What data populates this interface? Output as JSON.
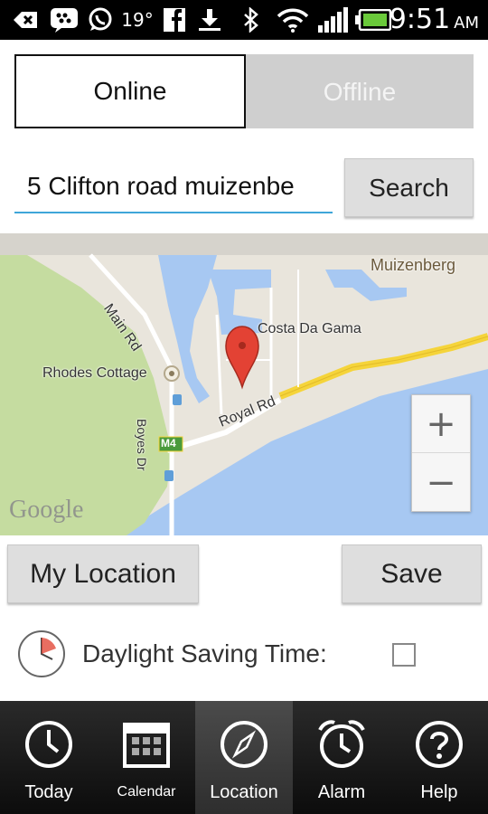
{
  "status_bar": {
    "temperature": "19°",
    "time": "9:51",
    "ampm": "AM",
    "icons": [
      "back-arrow-icon",
      "bbm-icon",
      "whatsapp-icon",
      "facebook-icon",
      "download-icon",
      "bluetooth-icon",
      "wifi-icon",
      "signal-icon",
      "battery-icon"
    ]
  },
  "mode_toggle": {
    "online_label": "Online",
    "offline_label": "Offline",
    "selected": "Online"
  },
  "search": {
    "value": "5 Clifton road muizenbe",
    "button_label": "Search"
  },
  "map": {
    "labels": {
      "muizenberg": "Muizenberg",
      "main_rd": "Main Rd",
      "costa_da_gama": "Costa Da Gama",
      "rhodes_cottage": "Rhodes Cottage",
      "royal_rd": "Royal Rd",
      "boyes_dr": "Boyes Dr",
      "m4": "M4"
    },
    "logo": "Google",
    "zoom_in": "+",
    "zoom_out": "−",
    "colors": {
      "water": "#a7c8f2",
      "land": "#e9e5dc",
      "park": "#c5dca0",
      "highway": "#f5d43a"
    }
  },
  "actions": {
    "my_location_label": "My Location",
    "save_label": "Save"
  },
  "dst": {
    "label": "Daylight Saving Time:",
    "checked": false
  },
  "bottom_nav": {
    "items": [
      {
        "label": "Today",
        "icon": "clock-icon"
      },
      {
        "label": "Calendar",
        "icon": "calendar-icon"
      },
      {
        "label": "Location",
        "icon": "compass-icon",
        "active": true
      },
      {
        "label": "Alarm",
        "icon": "alarm-clock-icon"
      },
      {
        "label": "Help",
        "icon": "help-icon"
      }
    ]
  }
}
